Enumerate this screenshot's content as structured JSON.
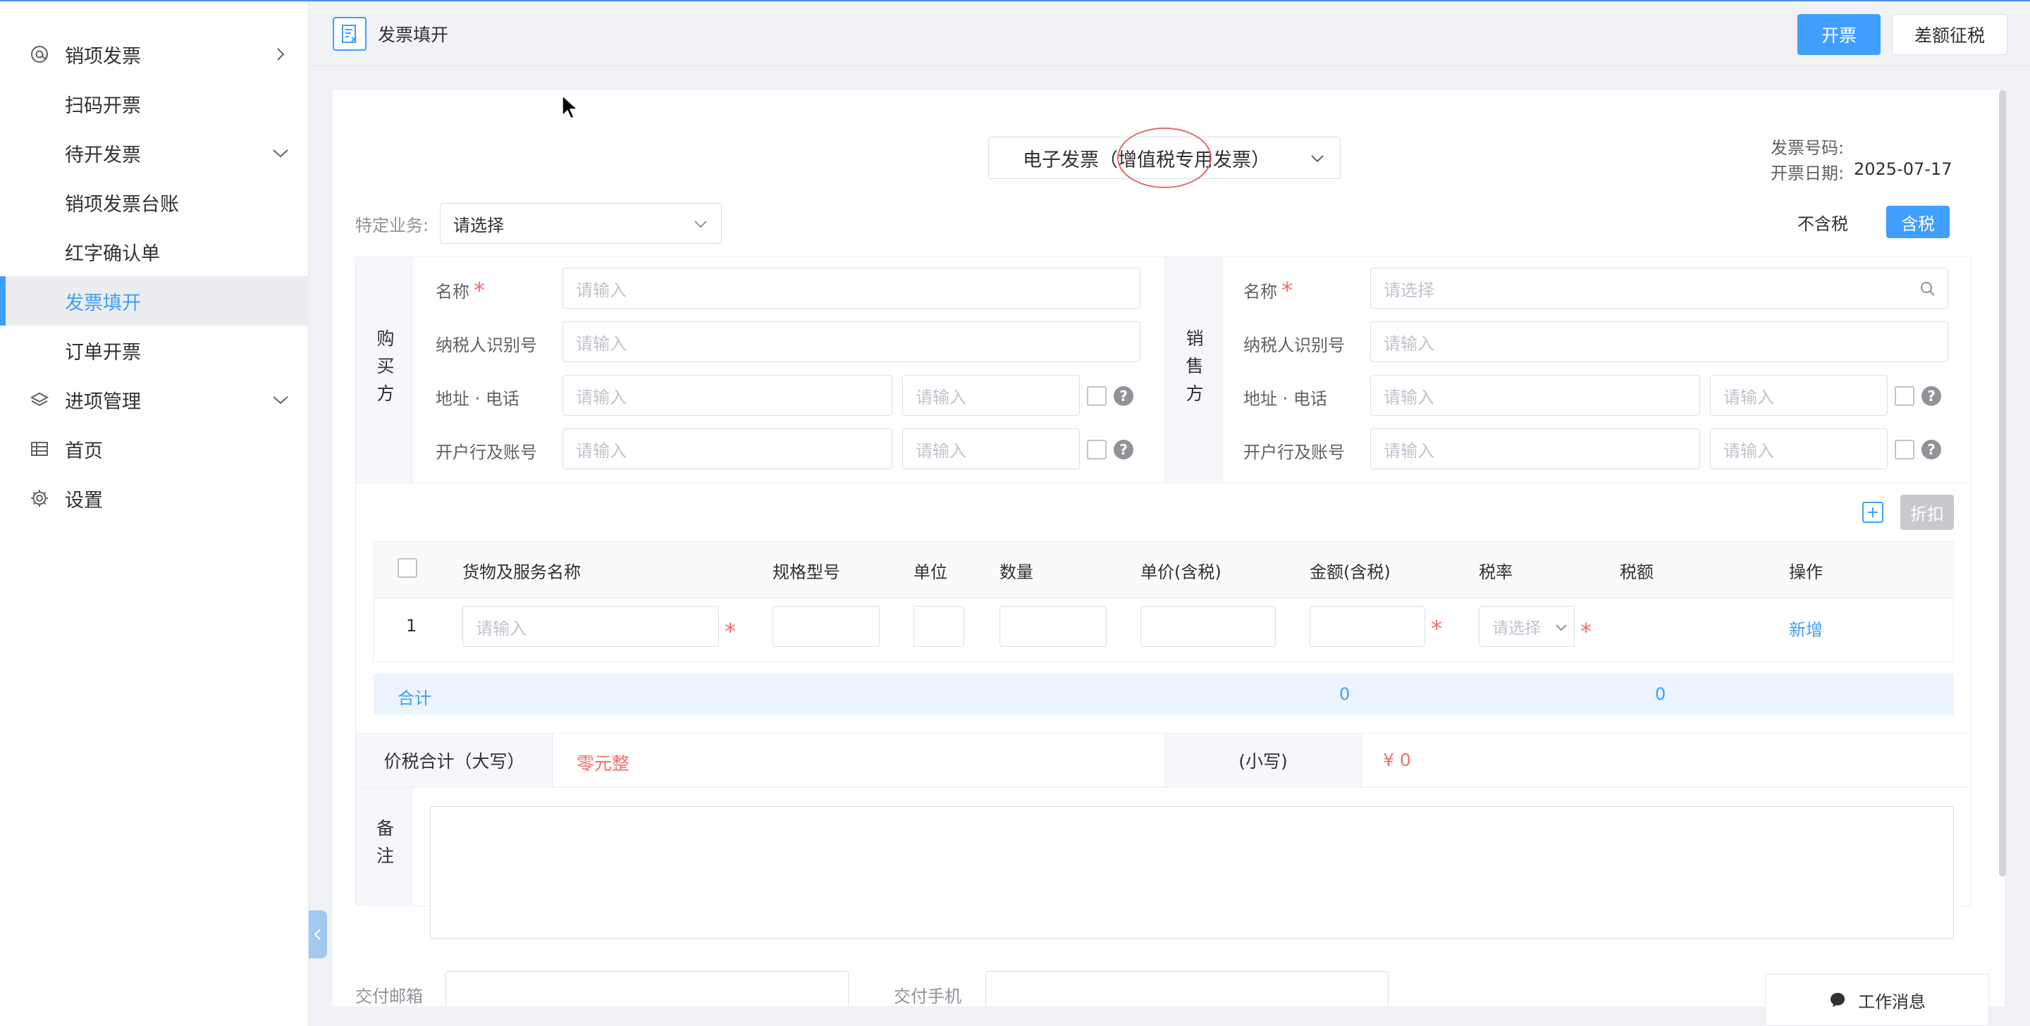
{
  "sidebar": {
    "items": [
      {
        "label": "销项发票",
        "icon": "at-icon",
        "arrow": "chevron-right-icon"
      },
      {
        "label": "扫码开票"
      },
      {
        "label": "待开发票",
        "arrow": "chevron-down-icon"
      },
      {
        "label": "销项发票台账"
      },
      {
        "label": "红字确认单"
      },
      {
        "label": "发票填开",
        "active": true
      },
      {
        "label": "订单开票"
      },
      {
        "label": "进项管理",
        "icon": "layers-icon",
        "arrow": "chevron-down-icon"
      },
      {
        "label": "首页",
        "icon": "table-icon"
      },
      {
        "label": "设置",
        "icon": "gear-icon"
      }
    ]
  },
  "header": {
    "title": "发票填开",
    "issue_button": "开票",
    "diff_tax_button": "差额征税"
  },
  "invoice": {
    "type_select": "电子发票（增值税专用发票）",
    "number_label": "发票号码:",
    "date_label": "开票日期:",
    "date_value": "2025-07-17",
    "special_business_label": "特定业务:",
    "special_business_placeholder": "请选择",
    "tax_excluded": "不含税",
    "tax_included": "含税"
  },
  "buyer": {
    "section_label": "购买方",
    "name_label": "名称",
    "name_placeholder": "请输入",
    "tax_id_label": "纳税人识别号",
    "tax_id_placeholder": "请输入",
    "address_label": "地址 · 电话",
    "address_placeholder": "请输入",
    "phone_placeholder": "请输入",
    "bank_label": "开户行及账号",
    "bank_placeholder": "请输入",
    "account_placeholder": "请输入"
  },
  "seller": {
    "section_label": "销售方",
    "name_label": "名称",
    "name_placeholder": "请选择",
    "tax_id_label": "纳税人识别号",
    "tax_id_placeholder": "请输入",
    "address_label": "地址 · 电话",
    "address_placeholder": "请输入",
    "phone_placeholder": "请输入",
    "bank_label": "开户行及账号",
    "bank_placeholder": "请输入",
    "account_placeholder": "请输入"
  },
  "items": {
    "discount_button": "折扣",
    "headers": [
      "货物及服务名称",
      "规格型号",
      "单位",
      "数量",
      "单价(含税)",
      "金额(含税)",
      "税率",
      "税额",
      "操作"
    ],
    "row_index": "1",
    "name_placeholder": "请输入",
    "tax_rate_placeholder": "请选择",
    "add_link": "新增",
    "total_label": "合计",
    "total_amount": "0",
    "total_tax": "0"
  },
  "totals": {
    "upper_label": "价税合计（大写）",
    "upper_value": "零元整",
    "lower_label": "(小写)",
    "lower_value": "¥ 0"
  },
  "remarks": {
    "label": "备注"
  },
  "delivery": {
    "email_label": "交付邮箱",
    "phone_label": "交付手机"
  },
  "work_message": {
    "label": "工作消息"
  },
  "colors": {
    "accent": "#409eff",
    "required": "#f56c6c",
    "annotation": "#e06c6c"
  }
}
